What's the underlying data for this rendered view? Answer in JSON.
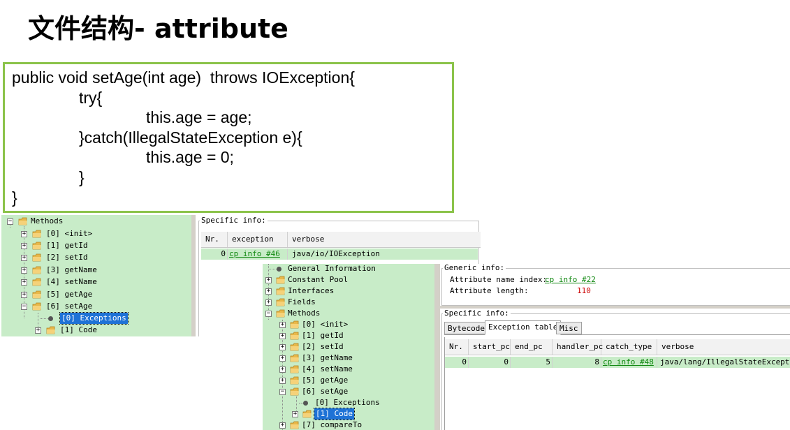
{
  "slide": {
    "title": "文件结构- attribute"
  },
  "code": {
    "lines": [
      "public void setAge(int age)  throws IOException{",
      "try{",
      "this.age = age;",
      "}catch(IllegalStateException e){",
      "this.age = 0;",
      "}",
      "}"
    ]
  },
  "tree1": {
    "root": "Methods",
    "items": [
      "[0] <init>",
      "[1] getId",
      "[2] setId",
      "[3] getName",
      "[4] setName",
      "[5] getAge",
      "[6] setAge"
    ],
    "child_selected": "[0] Exceptions",
    "child_code": "[1] Code"
  },
  "exceptions_panel": {
    "group_label": "Specific info:",
    "columns": [
      "Nr.",
      "exception",
      "verbose"
    ],
    "row": {
      "nr": "0",
      "exception": "cp info #46",
      "verbose": "java/io/IOException"
    }
  },
  "tree2": {
    "general": "General Information",
    "constant_pool": "Constant Pool",
    "interfaces": "Interfaces",
    "fields": "Fields",
    "methods": "Methods",
    "items": [
      "[0] <init>",
      "[1] getId",
      "[2] setId",
      "[3] getName",
      "[4] setName",
      "[5] getAge",
      "[6] setAge"
    ],
    "child_exceptions": "[0] Exceptions",
    "child_code": "[1] Code",
    "last_item": "[7] compareTo"
  },
  "code_panel": {
    "generic_label": "Generic info:",
    "name_index_label": "Attribute name index:",
    "name_index_value": "cp info #22",
    "length_label": "Attribute length:",
    "length_value": "110",
    "specific_label": "Specific info:",
    "tabs": [
      "Bytecode",
      "Exception table",
      "Misc"
    ],
    "columns": [
      "Nr.",
      "start_pc",
      "end_pc",
      "handler_pc",
      "catch_type",
      "verbose"
    ],
    "row": {
      "nr": "0",
      "start_pc": "0",
      "end_pc": "5",
      "handler_pc": "8",
      "catch_type": "cp info #48",
      "verbose": "java/lang/IllegalStateException"
    }
  },
  "colors": {
    "tree_bg": "#c8ecc8",
    "code_border": "#8bc34a",
    "selection": "#1e72d6",
    "link": "#118811",
    "value_red": "#cc0000"
  }
}
